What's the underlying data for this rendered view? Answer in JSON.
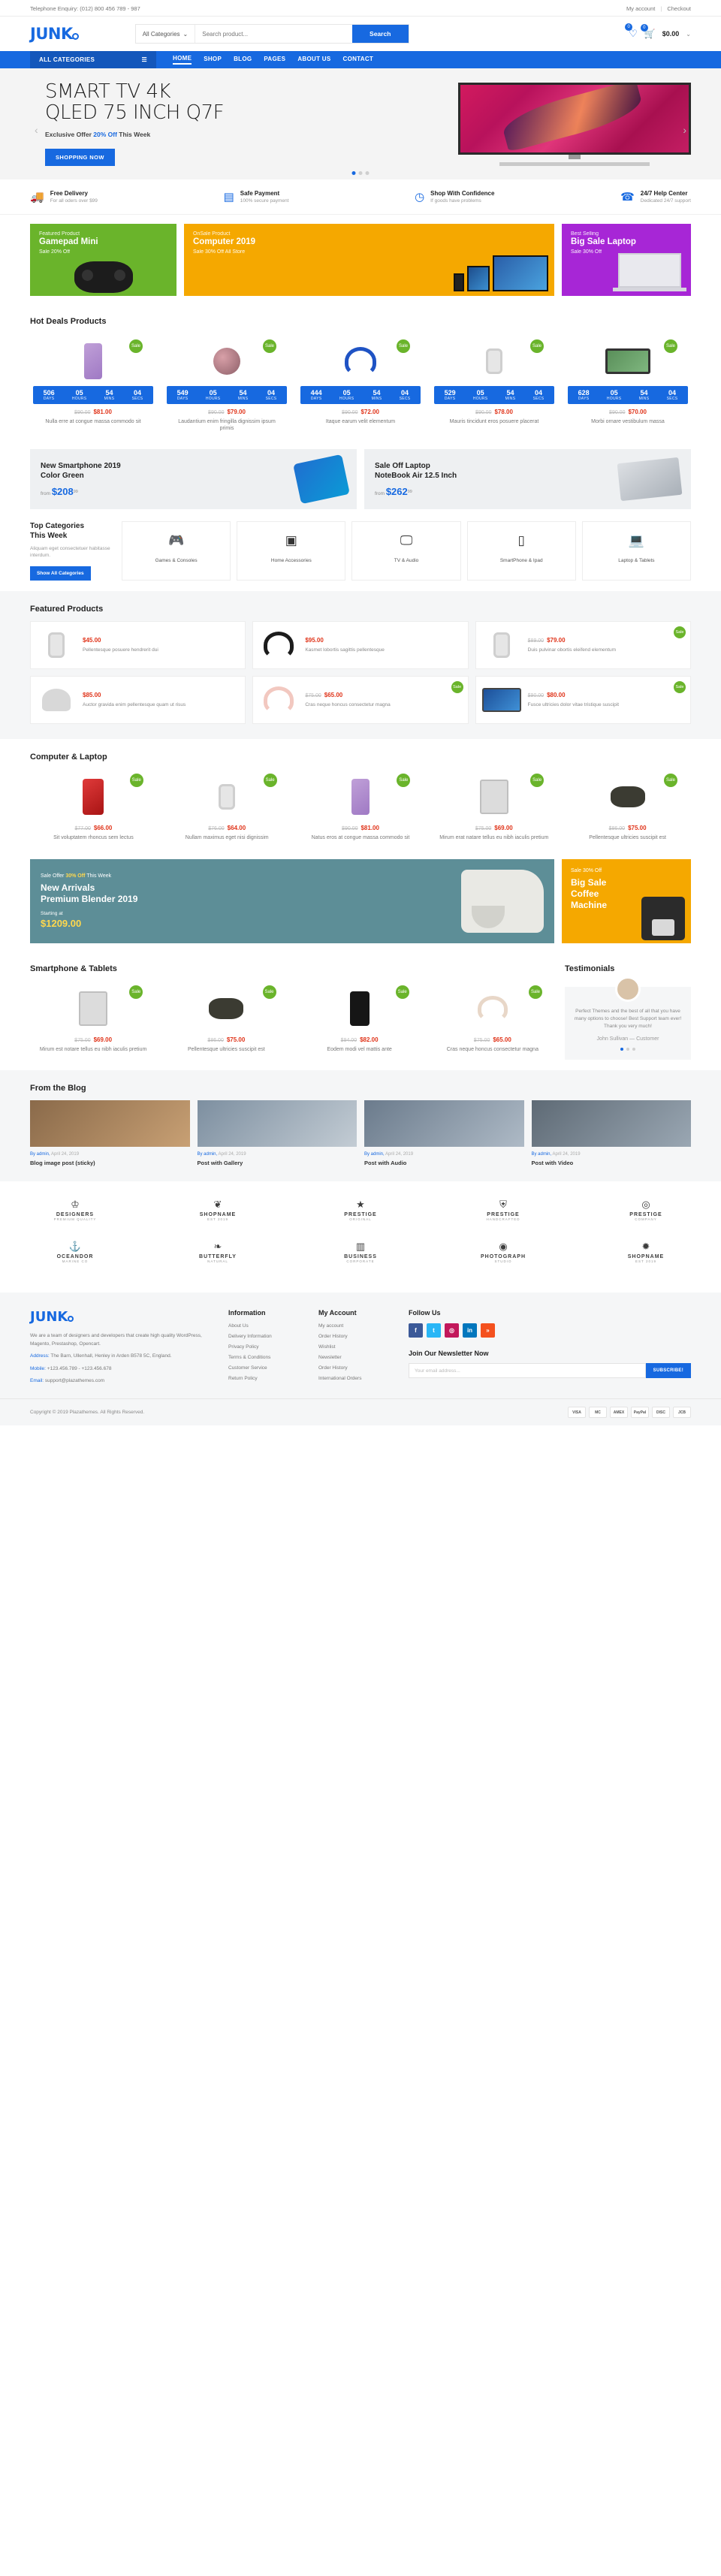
{
  "topbar": {
    "telephone": "Telephone Enquiry: (012) 800 456 789 - 987",
    "my_account": "My account",
    "separator": "|",
    "checkout": "Checkout"
  },
  "header": {
    "logo": "JUNK",
    "category_select": "All Categories",
    "search_placeholder": "Search product...",
    "search_button": "Search",
    "wishlist_count": "0",
    "cart_count": "0",
    "cart_total": "$0.00"
  },
  "nav": {
    "all_categories": "ALL CATEGORIES",
    "links": [
      {
        "label": "HOME",
        "active": true
      },
      {
        "label": "SHOP",
        "active": false
      },
      {
        "label": "BLOG",
        "active": false
      },
      {
        "label": "PAGES",
        "active": false
      },
      {
        "label": "ABOUT US",
        "active": false
      },
      {
        "label": "CONTACT",
        "active": false
      }
    ]
  },
  "hero": {
    "title_line1": "SMART TV 4K",
    "title_line2": "QLED 75 INCH Q7F",
    "sub_pre": "Exclusive Offer",
    "sub_highlight": "20% Off",
    "sub_post": "This Week",
    "button": "SHOPPING NOW"
  },
  "features": [
    {
      "icon": "truck-icon",
      "title": "Free Delivery",
      "sub": "For all oders over $99"
    },
    {
      "icon": "card-icon",
      "title": "Safe Payment",
      "sub": "100% secure payment"
    },
    {
      "icon": "confidence-icon",
      "title": "Shop With Confidence",
      "sub": "If goods have problems"
    },
    {
      "icon": "support-icon",
      "title": "24/7 Help Center",
      "sub": "Dedicated 24/7 support"
    }
  ],
  "promos": [
    {
      "kicker": "Featured Product",
      "title": "Gamepad Mini",
      "desc": "Sale 20% Off"
    },
    {
      "kicker": "OnSale Product",
      "title": "Computer 2019",
      "desc": "Sale 30% Off All Store"
    },
    {
      "kicker": "Best Selling",
      "title": "Big Sale Laptop",
      "desc": "Sale 30% Off"
    }
  ],
  "hot_deals": {
    "title": "Hot Deals Products",
    "timer_labels": [
      "DAYS",
      "HOURS",
      "MINS",
      "SECS"
    ],
    "sale_badge": "Sale",
    "items": [
      {
        "shape": "ph-phone",
        "days": "506",
        "hours": "05",
        "mins": "54",
        "secs": "04",
        "old": "$90.00",
        "new": "$81.00",
        "name": "Nulla erre at congue massa commodo sit"
      },
      {
        "shape": "ph-ear",
        "days": "549",
        "hours": "05",
        "mins": "54",
        "secs": "04",
        "old": "$90.00",
        "new": "$79.00",
        "name": "Laudantium enim fringilla dignissim ipsum primis"
      },
      {
        "shape": "ph-head",
        "days": "444",
        "hours": "05",
        "mins": "54",
        "secs": "04",
        "old": "$90.00",
        "new": "$72.00",
        "name": "Itaque earum velit elementum"
      },
      {
        "shape": "ph-watch",
        "days": "529",
        "hours": "05",
        "mins": "54",
        "secs": "04",
        "old": "$90.00",
        "new": "$78.00",
        "name": "Mauris tincidunt eros posuere placerat"
      },
      {
        "shape": "ph-tv",
        "days": "628",
        "hours": "05",
        "mins": "54",
        "secs": "04",
        "old": "$90.00",
        "new": "$70.00",
        "name": "Morbi ornare vestibulum massa"
      }
    ]
  },
  "two_banners": [
    {
      "title": "New Smartphone 2019 Color Green",
      "from": "from",
      "price": "$208",
      "cents": "99",
      "art": "sp-phone"
    },
    {
      "title": "Sale Off Laptop NoteBook Air 12.5 Inch",
      "from": "from",
      "price": "$262",
      "cents": "99",
      "art": "sp-lap"
    }
  ],
  "top_categories": {
    "title_l1": "Top Categories",
    "title_l2": "This Week",
    "desc": "Aliquam eget consectetuer habitasse interdum.",
    "button": "Show All Categories",
    "items": [
      {
        "icon": "gamepad-icon",
        "label": "Games & Consoles"
      },
      {
        "icon": "microwave-icon",
        "label": "Home Accessories"
      },
      {
        "icon": "tv-icon",
        "label": "TV & Audio"
      },
      {
        "icon": "phone-icon",
        "label": "SmartPhone & Ipad"
      },
      {
        "icon": "laptop-icon",
        "label": "Laptop & Tablets"
      }
    ]
  },
  "featured_products": {
    "title": "Featured Products",
    "sale_badge": "Sale",
    "items": [
      {
        "shape": "ph-watch",
        "old": "",
        "new": "$45.00",
        "name": "Pellentesque posuere hendrerit dui",
        "badge": false
      },
      {
        "shape": "ph-blk-head",
        "old": "",
        "new": "$95.00",
        "name": "Kasmet lobortis sagittis pellentesque",
        "badge": false
      },
      {
        "shape": "ph-watch",
        "old": "$89.00",
        "new": "$79.00",
        "name": "Duis pulvinar obortis eleifend elementum",
        "badge": true
      },
      {
        "shape": "ph-spk",
        "old": "",
        "new": "$85.00",
        "name": "Auctor gravida enim pellentesque quam ut risus",
        "badge": false
      },
      {
        "shape": "ph-hpink",
        "old": "$75.00",
        "new": "$65.00",
        "name": "Cras neque honcus consectetur magna",
        "badge": true
      },
      {
        "shape": "ph-mon",
        "old": "$90.00",
        "new": "$80.00",
        "name": "Fusce ultricies dolor vitae tristique suscipit",
        "badge": true
      }
    ]
  },
  "computer_laptop": {
    "title": "Computer & Laptop",
    "sale_badge": "Sale",
    "items": [
      {
        "shape": "ph-red",
        "old": "$77.00",
        "new": "$66.00",
        "name": "Sit voluptatem rhoncus sem lectus"
      },
      {
        "shape": "ph-watch",
        "old": "$76.00",
        "new": "$64.00",
        "name": "Nullam maximus eget nisi dignissim"
      },
      {
        "shape": "ph-phone",
        "old": "$90.00",
        "new": "$81.00",
        "name": "Natus eros at congue massa commodo sit"
      },
      {
        "shape": "ph-tab",
        "old": "$75.00",
        "new": "$69.00",
        "name": "Mirum erat natare tellus eu nibh iaculis pretium"
      },
      {
        "shape": "ph-pad",
        "old": "$86.00",
        "new": "$75.00",
        "name": "Pellentesque ultricies suscipit est"
      }
    ]
  },
  "big_banners": {
    "left": {
      "kicker_pre": "Sale Offer",
      "kicker_hl": "30% Off",
      "kicker_post": "This Week",
      "title_l1": "New Arrivals",
      "title_l2": "Premium Blender 2019",
      "price_label": "Starting at",
      "price": "$1209.00"
    },
    "right": {
      "kicker": "Sale 30% Off",
      "title_l1": "Big Sale",
      "title_l2": "Coffee",
      "title_l3": "Machine"
    }
  },
  "smartphone_tablets": {
    "title": "Smartphone & Tablets",
    "sale_badge": "Sale",
    "items": [
      {
        "shape": "ph-tab",
        "old": "$75.00",
        "new": "$69.00",
        "name": "Mirum est notare tellus eu nibh iaculis pretium"
      },
      {
        "shape": "ph-pad",
        "old": "$86.00",
        "new": "$75.00",
        "name": "Pellentesque ultricies suscipit est"
      },
      {
        "shape": "ph-black",
        "old": "$94.00",
        "new": "$82.00",
        "name": "Eodem modi vel mattis ante"
      },
      {
        "shape": "ph-beige",
        "old": "$75.00",
        "new": "$65.00",
        "name": "Cras neque honcus consectetur magna"
      }
    ]
  },
  "testimonials": {
    "title": "Testimonials",
    "quote": "Perfect Themes and the best of all that you have many options to choose! Best Support team ever! Thank you very much!",
    "author": "John Sullivan",
    "role": "— Customer"
  },
  "blog": {
    "title": "From the Blog",
    "posts": [
      {
        "author": "By admin,",
        "date": "April 24, 2019",
        "title": "Blog image post (sticky)"
      },
      {
        "author": "By admin,",
        "date": "April 24, 2019",
        "title": "Post with Gallery"
      },
      {
        "author": "By admin,",
        "date": "April 24, 2019",
        "title": "Post with Audio"
      },
      {
        "author": "By admin,",
        "date": "April 24, 2019",
        "title": "Post with Video"
      }
    ]
  },
  "brands": {
    "row1": [
      {
        "icon": "crown-icon",
        "name": "DESIGNERS",
        "sub": "PREMIUM QUALITY"
      },
      {
        "icon": "wreath-icon",
        "name": "SHOPNAME",
        "sub": "EST 2019"
      },
      {
        "icon": "star-icon",
        "name": "PRESTIGE",
        "sub": "ORIGINAL"
      },
      {
        "icon": "shield-icon",
        "name": "PRESTIGE",
        "sub": "HANDCRAFTED"
      },
      {
        "icon": "circle-icon",
        "name": "PRESTIGE",
        "sub": "COMPANY"
      }
    ],
    "row2": [
      {
        "icon": "anchor-icon",
        "name": "OCEANDOR",
        "sub": "MARINE CO"
      },
      {
        "icon": "leaf-icon",
        "name": "BUTTERFLY",
        "sub": "NATURAL"
      },
      {
        "icon": "building-icon",
        "name": "BUSINESS",
        "sub": "CORPORATE"
      },
      {
        "icon": "camera-icon",
        "name": "PHOTOGRAPH",
        "sub": "STUDIO"
      },
      {
        "icon": "badge-icon",
        "name": "SHOPNAME",
        "sub": "EST 2019"
      }
    ]
  },
  "footer": {
    "logo": "JUNK",
    "description": "We are a team of designers and developers that create high quality WordPress, Magento, Prestashop, Opencart.",
    "address_label": "Address:",
    "address_value": "The Barn, Ullenhall, Henley in Arden B578 5C, England.",
    "mobile_label": "Mobile:",
    "mobile_value": "+123.456.789 - +123.456.678",
    "email_label": "Email:",
    "email_value": "support@plazathemes.com",
    "information": {
      "heading": "Information",
      "links": [
        "About Us",
        "Delivery Information",
        "Privacy Policy",
        "Terms & Conditions",
        "Customer Service",
        "Return Policy"
      ]
    },
    "my_account": {
      "heading": "My Account",
      "links": [
        "My account",
        "Order History",
        "Wishlist",
        "Newsletter",
        "Order History",
        "International Orders"
      ]
    },
    "follow": {
      "heading": "Follow Us",
      "socials": [
        {
          "name": "facebook-icon",
          "glyph": "f",
          "color": "#3b5998"
        },
        {
          "name": "twitter-icon",
          "glyph": "t",
          "color": "#29b6f6"
        },
        {
          "name": "instagram-icon",
          "glyph": "◎",
          "color": "#c2185b"
        },
        {
          "name": "linkedin-icon",
          "glyph": "in",
          "color": "#0277bd"
        },
        {
          "name": "rss-icon",
          "glyph": "»",
          "color": "#f4511e"
        }
      ]
    },
    "newsletter": {
      "heading": "Join Our Newsletter Now",
      "placeholder": "Your email address...",
      "button": "SUBSCRIBE!"
    }
  },
  "copyright": {
    "text": "Copyright © 2019 Plazathemes. All Rights Reserved.",
    "payments": [
      "VISA",
      "MC",
      "AMEX",
      "PayPal",
      "DISC",
      "JCB"
    ]
  },
  "colors": {
    "brand": "#1769e0",
    "sale_green": "#6ab42b",
    "price_red": "#e0341a",
    "promo_orange": "#f5a800",
    "promo_purple": "#a726d6"
  }
}
